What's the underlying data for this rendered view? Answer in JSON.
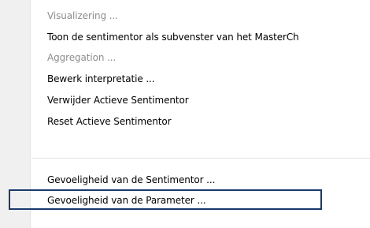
{
  "context_menu": {
    "items": [
      {
        "label": "Visualizering ...",
        "enabled": false
      },
      {
        "label": "Toon de sentimentor als subvenster van het MasterCh",
        "enabled": true
      },
      {
        "label": "Aggregation ...",
        "enabled": false
      },
      {
        "label": "Bewerk interpretatie ...",
        "enabled": true
      },
      {
        "label": "Verwijder Actieve Sentimentor",
        "enabled": true
      },
      {
        "label": "Reset Actieve Sentimentor",
        "enabled": true
      },
      {
        "label": "Gevoeligheid van de Sentimentor ...",
        "enabled": true
      },
      {
        "label": "Gevoeligheid van de Parameter ...",
        "enabled": true,
        "highlighted": true
      }
    ]
  },
  "colors": {
    "gutter": "#f0f0f0",
    "menu_background": "#ffffff",
    "disabled_text": "#8d8d8d",
    "highlight_border": "#183a6b"
  }
}
